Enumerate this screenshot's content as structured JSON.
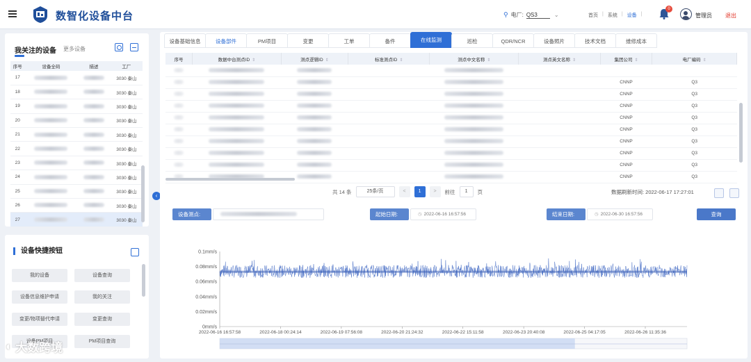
{
  "header": {
    "app_title": "数智化设备中台",
    "plant_label": "电厂:",
    "plant_value": "QS3",
    "links": [
      "首页",
      "系统",
      "设备"
    ],
    "active_link_index": 2,
    "notification_count": "0",
    "username": "管理员",
    "logout_label": "退出"
  },
  "followed": {
    "title": "我关注的设备",
    "more_label": "更多设备",
    "columns": [
      "序号",
      "设备全码",
      "描述",
      "工厂"
    ],
    "rows": [
      {
        "no": "17",
        "plant": "3030 秦山"
      },
      {
        "no": "18",
        "plant": "3030 秦山"
      },
      {
        "no": "19",
        "plant": "3030 秦山"
      },
      {
        "no": "20",
        "plant": "3030 秦山"
      },
      {
        "no": "21",
        "plant": "3030 秦山"
      },
      {
        "no": "22",
        "plant": "3030 秦山"
      },
      {
        "no": "23",
        "plant": "3030 秦山"
      },
      {
        "no": "24",
        "plant": "3030 秦山"
      },
      {
        "no": "25",
        "plant": "3030 秦山"
      },
      {
        "no": "26",
        "plant": "3030 秦山"
      },
      {
        "no": "27",
        "plant": "3030 秦山"
      }
    ],
    "selected_index": 10
  },
  "quick": {
    "title": "设备快捷按钮",
    "buttons": [
      "我的设备",
      "设备查询",
      "设备信息维护申请",
      "我的关注",
      "变更/物项替代申请",
      "变更查询",
      "设备PM项目",
      "PM项目查询"
    ]
  },
  "tabs": [
    {
      "label": "设备基础信息"
    },
    {
      "label": "设备部件"
    },
    {
      "label": "PM项目"
    },
    {
      "label": "变更"
    },
    {
      "label": "工单"
    },
    {
      "label": "备件"
    },
    {
      "label": "在线监测"
    },
    {
      "label": "巡检"
    },
    {
      "label": "QDR/NCR"
    },
    {
      "label": "设备照片"
    },
    {
      "label": "技术文档"
    },
    {
      "label": "维修成本"
    }
  ],
  "active_tab_index": 6,
  "sub_tab_index": 1,
  "table": {
    "columns": [
      "序号",
      "数据中台测点ID",
      "测点逻辑ID",
      "标准测点ID",
      "测点中文名称",
      "测点英文名称",
      "集团公司",
      "电厂编码"
    ],
    "rows": [
      {
        "company": "",
        "plant": ""
      },
      {
        "company": "CNNP",
        "plant": "Q3"
      },
      {
        "company": "CNNP",
        "plant": "Q3"
      },
      {
        "company": "CNNP",
        "plant": "Q3"
      },
      {
        "company": "CNNP",
        "plant": "Q3"
      },
      {
        "company": "CNNP",
        "plant": "Q3"
      },
      {
        "company": "CNNP",
        "plant": "Q3"
      },
      {
        "company": "CNNP",
        "plant": "Q3"
      },
      {
        "company": "CNNP",
        "plant": "Q3"
      },
      {
        "company": "CNNP",
        "plant": "Q3"
      }
    ]
  },
  "pagination": {
    "total": "共 14 条",
    "page_size": "25条/页",
    "prev": "<",
    "current": "1",
    "next": ">",
    "goto_label": "前往",
    "goto_value": "1",
    "page_suffix": "页"
  },
  "refresh_time": "数据刷新时间: 2022-06-17 17:27:01",
  "filters": {
    "point_label": "设备测点:",
    "start_label": "起始日期:",
    "start_value": "2022-06-16 16:57:56",
    "end_label": "结束日期:",
    "end_value": "2022-06-30 16:57:56",
    "query_label": "查询"
  },
  "chart_data": {
    "type": "line",
    "ylabel": "",
    "ylim": [
      0,
      0.1
    ],
    "y_ticks": [
      "0.1mm/s",
      "0.08mm/s",
      "0.06mm/s",
      "0.04mm/s",
      "0.02mm/s",
      "0mm/s"
    ],
    "x_ticks": [
      "2022-06-16 16:57:58",
      "2022-06-18 00:24:14",
      "2022-06-19 07:56:08",
      "2022-06-20 21:24:32",
      "2022-06-22 15:11:58",
      "2022-06-23 20:40:08",
      "2022-06-25 04:17:05",
      "2022-06-26 11:35:36"
    ],
    "series": [
      {
        "name": "",
        "color": "#4f74c8",
        "x_range": [
          "2022-06-16 16:57:58",
          "2022-06-26 23:59:59"
        ],
        "mean": 0.073,
        "band": [
          0.065,
          0.082
        ],
        "spike_max": 0.092
      }
    ],
    "grid": false,
    "zoom_slider": {
      "start": 0,
      "end": 0.76
    }
  },
  "watermark": "大数跨境"
}
